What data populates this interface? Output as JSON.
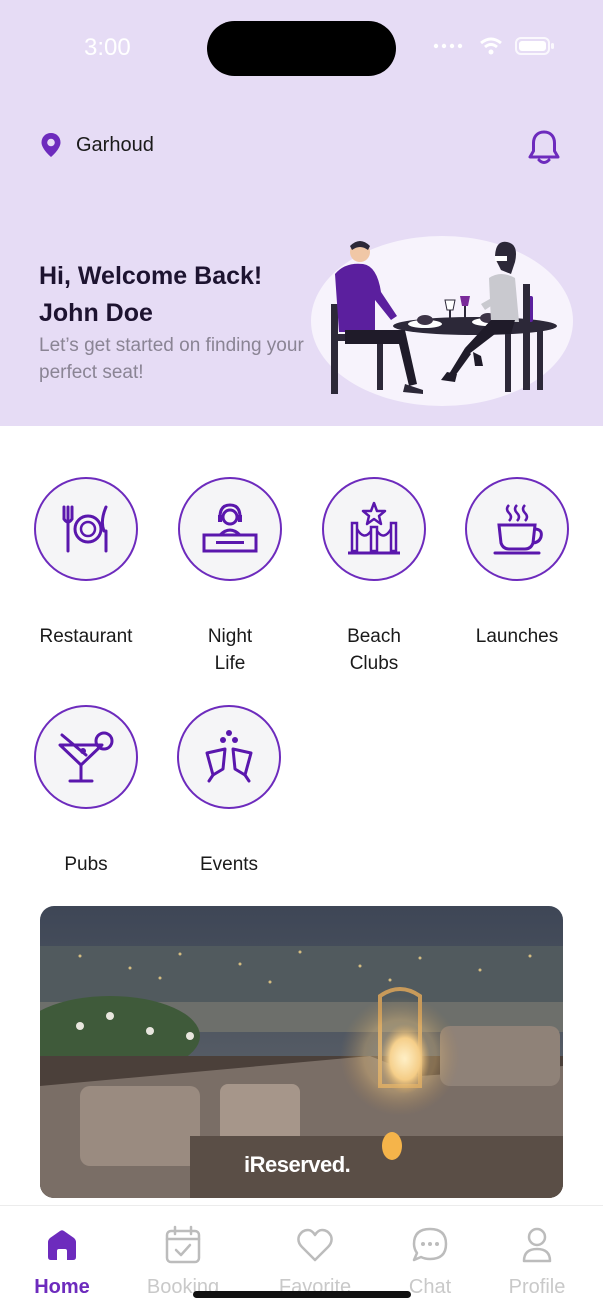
{
  "status": {
    "time": "3:00"
  },
  "location": {
    "name": "Garhoud"
  },
  "welcome": {
    "greeting": "Hi, Welcome Back!",
    "name": "John Doe",
    "subtitle": "Let’s get started on finding your perfect seat!"
  },
  "categories": [
    {
      "label": "Restaurant",
      "icon": "plate-cutlery-icon"
    },
    {
      "label": "Night Life",
      "icon": "dj-icon"
    },
    {
      "label": "Beach Clubs",
      "icon": "stanchion-star-icon"
    },
    {
      "label": "Launches",
      "icon": "coffee-cup-icon"
    },
    {
      "label": "Pubs",
      "icon": "cocktail-icon"
    },
    {
      "label": "Events",
      "icon": "cheers-icon"
    }
  ],
  "banner": {
    "logo": "iReserved."
  },
  "tabs": [
    {
      "label": "Home",
      "icon": "home-icon",
      "active": true
    },
    {
      "label": "Booking",
      "icon": "calendar-icon"
    },
    {
      "label": "Favorite",
      "icon": "heart-icon"
    },
    {
      "label": "Chat",
      "icon": "chat-icon"
    },
    {
      "label": "Profile",
      "icon": "profile-icon"
    }
  ],
  "colors": {
    "accent": "#6d2bbd",
    "header_bg": "#e6dcf5",
    "inactive": "#c9c9c9"
  }
}
